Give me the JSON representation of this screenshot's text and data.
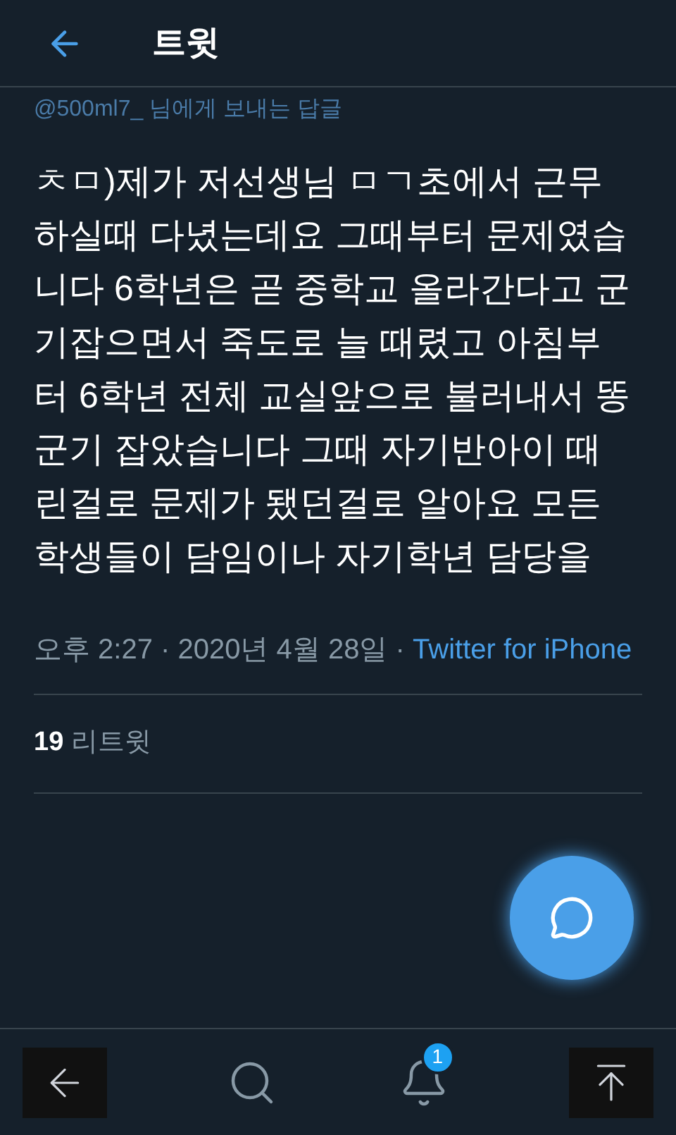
{
  "header": {
    "title": "트윗"
  },
  "tweet": {
    "reply_to": "@500ml7_ 님에게 보내는 답글",
    "text": "ㅊㅁ)제가 저선생님 ㅁㄱ초에서 근무하실때 다녔는데요 그때부터 문제였습니다 6학년은 곧 중학교 올라간다고 군기잡으면서 죽도로 늘 때렸고 아침부터 6학년 전체 교실앞으로 불러내서 똥군기 잡았습니다 그때 자기반아이 때린걸로 문제가 됐던걸로 알아요 모든학생들이 담임이나 자기학년 담당을",
    "time": "오후 2:27 · 2020년 4월 28일 · ",
    "source": "Twitter for iPhone",
    "retweet_count": "19",
    "retweet_label": "리트윗"
  },
  "bottom_nav": {
    "notification_badge": "1"
  }
}
